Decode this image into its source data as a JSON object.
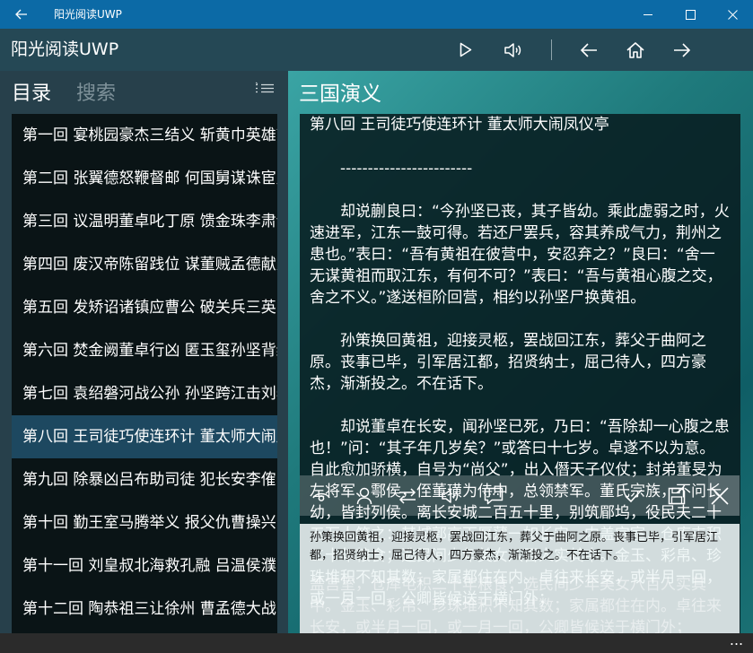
{
  "window": {
    "title": "阳光阅读UWP",
    "back_icon": "arrow-left-icon",
    "minimize_icon": "minimize-icon",
    "maximize_icon": "maximize-icon",
    "close_icon": "close-icon"
  },
  "appbar": {
    "title": "阳光阅读UWP",
    "buttons": [
      "play-icon",
      "volume-icon",
      "arrow-left-icon",
      "home-icon",
      "arrow-right-icon"
    ]
  },
  "sidebar": {
    "tabs": {
      "toc": "目录",
      "search": "搜索"
    },
    "sort_icon": "sort-list-icon",
    "chapters": [
      {
        "label": "第一回 宴桃园豪杰三结义 斩黄巾英雄首立功"
      },
      {
        "label": "第二回 张翼德怒鞭督邮 何国舅谋诛宦竖"
      },
      {
        "label": "第三回 议温明董卓叱丁原 馈金珠李肃说吕布"
      },
      {
        "label": "第四回 废汉帝陈留践位 谋董贼孟德献刀"
      },
      {
        "label": "第五回 发矫诏诸镇应曹公 破关兵三英战吕布"
      },
      {
        "label": "第六回 焚金阙董卓行凶 匿玉玺孙坚背约"
      },
      {
        "label": "第七回 袁绍磐河战公孙 孙坚跨江击刘表"
      },
      {
        "label": "第八回 王司徒巧使连环计 董太师大闹凤仪亭"
      },
      {
        "label": "第九回 除暴凶吕布助司徒 犯长安李傕听贾诩"
      },
      {
        "label": "第十回 勤王室马腾举义 报父仇曹操兴师"
      },
      {
        "label": "第十一回 刘皇叔北海救孔融 吕温侯濮阳破曹操"
      },
      {
        "label": "第十二回 陶恭祖三让徐州 曹孟德大战吕布"
      }
    ],
    "selected_index": 7
  },
  "reader": {
    "book_title": "三国演义",
    "chapter_title": "第八回 王司徒巧使连环计 董太师大闹凤仪亭",
    "paragraphs": [
      "　　------------------------",
      "",
      "　　却说蒯良曰：“今孙坚已丧，其子皆幼。乘此虚弱之时，火速进军，江东一鼓可得。若还尸罢兵，容其养成气力，荆州之患也。”表曰：“吾有黄祖在彼营中，安忍弃之？”良曰：“舍一无谋黄祖而取江东，有何不可？”表曰：“吾与黄祖心腹之交，舍之不义。”遂送桓阶回营，相约以孙坚尸换黄祖。",
      "",
      "　　孙策换回黄祖，迎接灵柩，罢战回江东，葬父于曲阿之原。丧事已毕，引军居江都，招贤纳士，屈己待人，四方豪杰，渐渐投之。不在话下。",
      "",
      "　　却说董卓在长安，闻孙坚已死，乃曰：“吾除却一心腹之患也！”问：“其子年几岁矣？”或答曰十七岁。卓遂不以为意。自此愈加骄横，自号为“尚父”，出入僭天子仪仗；封弟董旻为左将军、鄠侯，侄董璜为侍中，总领禁军。董氏宗族，不问长幼，皆封列侯。离长安城二百五十里，别筑郿坞，役民夫二十五万人筑之：其城郭高下厚薄一如长安，内盖宫室，仓库屯积二十年粮食；选民间少年美女八百人实其中。金玉、彩帛、珍珠堆积不知其数；家属都住在内。卓往来长安，或半月一回，或一月一回，公卿皆候送于横门外；"
    ]
  },
  "toolbar": {
    "icons": [
      "eye-icon",
      "person-icon",
      "swap-icon",
      "volume-icon",
      "comment-icon",
      "check-icon",
      "save-icon",
      "close-icon"
    ]
  },
  "selection": {
    "text": "孙策换回黄祖，迎接灵柩，罢战回江东，葬父于曲阿之原。丧事已毕，引军居江都，招贤纳士，屈己待人，四方豪杰，渐渐投之。不在话下。",
    "underlay": "盖宫室，仓库屯积二十年粮食；选民间少年美女八百人实其中。金玉、彩帛、珍珠堆积不知其数；家属都住在内。卓往来长安，或半月一回，或一月一回，公卿皆候送于横门外；"
  },
  "statusbar": {
    "more_label": "..."
  }
}
